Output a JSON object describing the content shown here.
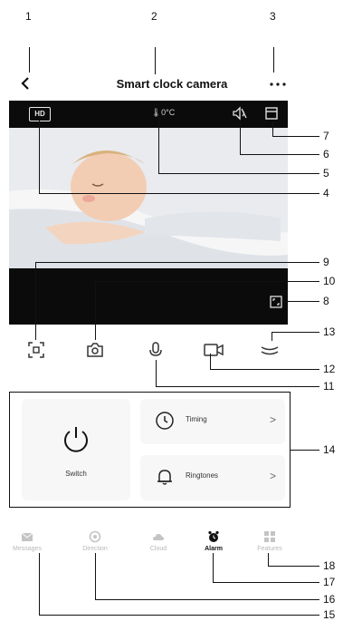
{
  "callouts": [
    "1",
    "2",
    "3",
    "4",
    "5",
    "6",
    "7",
    "8",
    "9",
    "10",
    "11",
    "12",
    "13",
    "14",
    "15",
    "16",
    "17",
    "18"
  ],
  "header": {
    "title": "Smart clock camera"
  },
  "video": {
    "hd_label": "HD",
    "temperature": "0°C"
  },
  "panel": {
    "switch_label": "Switch",
    "timing_label": "Timing",
    "ringtones_label": "Ringtones",
    "arrow": ">"
  },
  "tabs": [
    {
      "label": "Messages",
      "icon": "envelope-icon"
    },
    {
      "label": "Direction",
      "icon": "direction-icon"
    },
    {
      "label": "Cloud",
      "icon": "cloud-icon"
    },
    {
      "label": "Alarm",
      "icon": "alarm-clock-icon",
      "active": true
    },
    {
      "label": "Features",
      "icon": "grid-icon"
    }
  ],
  "colors": {
    "video_bar": "#0b0b0b",
    "card_bg": "#f7f7f7",
    "inactive_tab": "#b8b8b8"
  }
}
